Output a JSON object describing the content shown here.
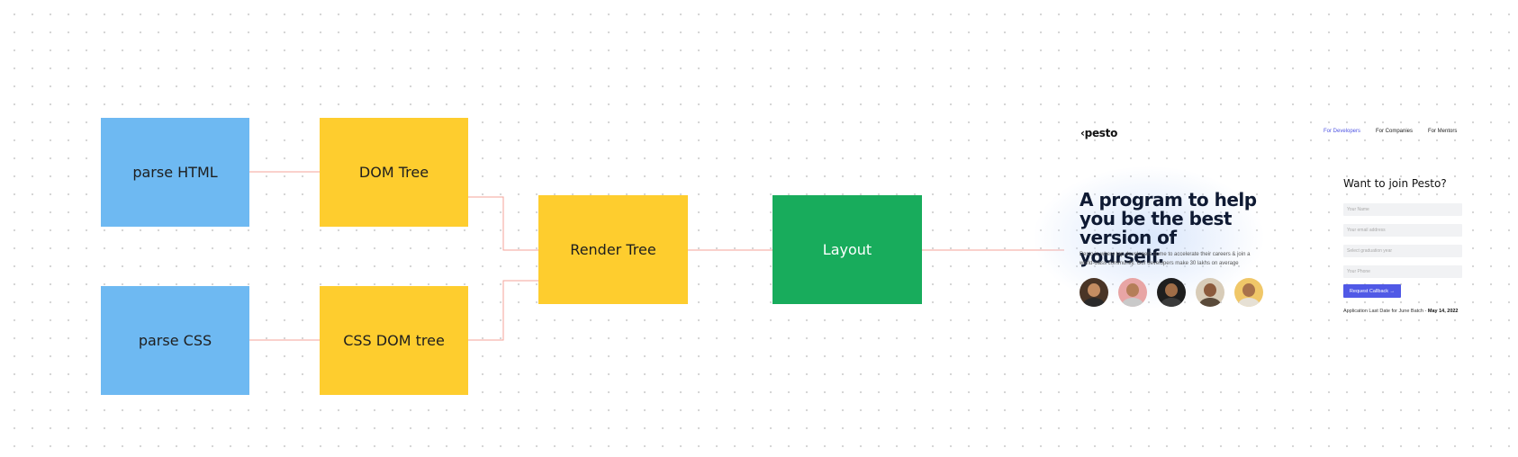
{
  "diagram": {
    "nodes": {
      "parse_html": "parse HTML",
      "parse_css": "parse CSS",
      "dom_tree": "DOM Tree",
      "css_dom_tree": "CSS DOM tree",
      "render_tree": "Render Tree",
      "layout": "Layout"
    },
    "colors": {
      "parse": "#6eb9f2",
      "tree": "#fecd2e",
      "layout": "#18ac5c",
      "connector": "#f4a39a"
    }
  },
  "preview": {
    "logo": "pesto",
    "nav": [
      "For Developers",
      "For Companies",
      "For Mentors"
    ],
    "headline": "A program to help you be the best version of yourself.",
    "description": "Pesto is where top developers come to accelerate their careers & join a world-class community. Our developers make 30 lakhs on average",
    "form": {
      "title": "Want to join Pesto?",
      "placeholders": [
        "Your Name",
        "Your email address",
        "Select graduation year",
        "Your Phone"
      ],
      "button": "Request Callback →",
      "deadline_text": "Application Last Date for June Batch - ",
      "deadline_date": "May 14, 2022"
    },
    "accent_color": "#5059e6"
  }
}
